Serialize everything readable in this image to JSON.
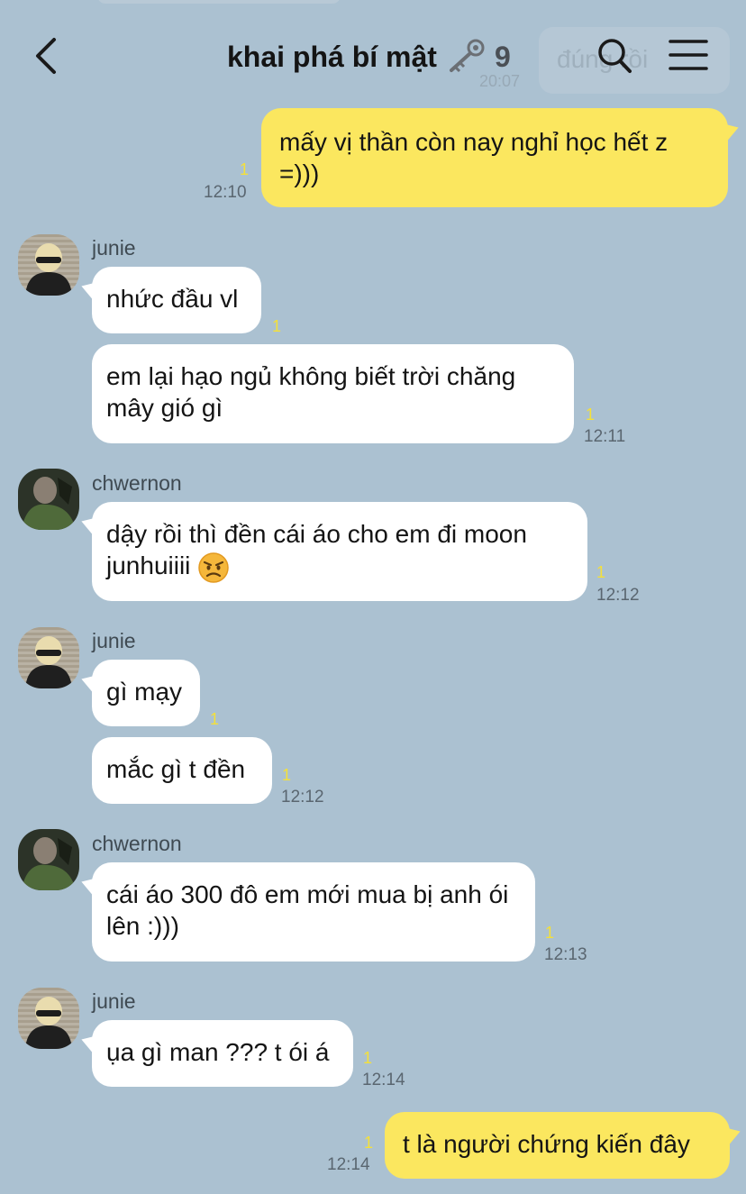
{
  "header": {
    "title": "khai phá bí mật",
    "member_count": "9",
    "ghost_bubble_text": "đúng rồi",
    "ghost_time": "20:07"
  },
  "colors": {
    "background": "#abc1d1",
    "my_bubble": "#fbe75f",
    "their_bubble": "#ffffff",
    "unread": "#f4e03a"
  },
  "messages": [
    {
      "text": "mấy vị thần còn nay nghỉ học hết z =)))",
      "unread": "1",
      "time": "12:10"
    },
    {
      "sender": "junie",
      "text": "nhức đầu vl",
      "unread": "1"
    },
    {
      "text": "em lại hạo ngủ không biết trời chăng mây gió gì",
      "unread": "1",
      "time": "12:11"
    },
    {
      "sender": "chwernon",
      "text": "dậy rồi thì đền cái áo cho em đi moon junhuiiii",
      "emoji": "angry-face-emoji",
      "unread": "1",
      "time": "12:12"
    },
    {
      "sender": "junie",
      "text": "gì mạy",
      "unread": "1"
    },
    {
      "text": "mắc gì t đền",
      "unread": "1",
      "time": "12:12"
    },
    {
      "sender": "chwernon",
      "text": "cái áo 300 đô em mới mua bị anh ói lên :)))",
      "unread": "1",
      "time": "12:13"
    },
    {
      "sender": "junie",
      "text": "ụa gì man ??? t ói á",
      "unread": "1",
      "time": "12:14"
    },
    {
      "text": "t là người chứng kiến đây",
      "unread": "1",
      "time": "12:14"
    }
  ]
}
